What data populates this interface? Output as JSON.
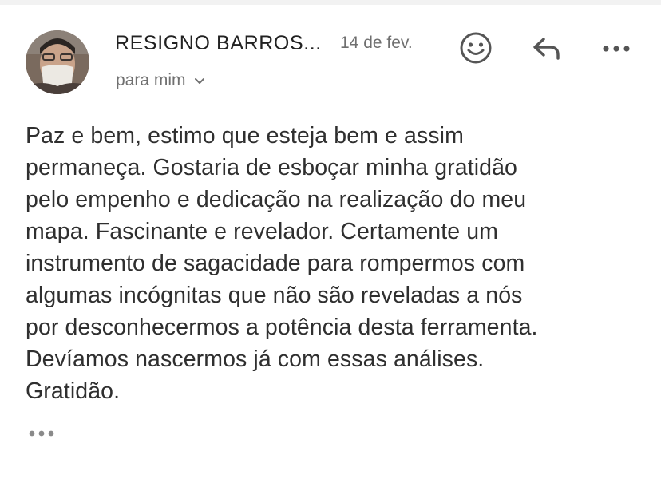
{
  "header": {
    "sender_name": "RESIGNO BARROS...",
    "date": "14 de fev.",
    "recipient": "para mim",
    "icons": {
      "avatar": "sender-avatar",
      "emoji": "emoji-reaction-icon",
      "reply": "reply-icon",
      "more": "more-options-icon",
      "recipient_toggle": "chevron-down-icon"
    }
  },
  "message": {
    "lines": [
      "Paz e bem, estimo que esteja bem e assim",
      "permaneça. Gostaria de esboçar minha gratidão",
      "pelo empenho e dedicação na realização do meu",
      "mapa. Fascinante e revelador. Certamente um",
      "instrumento de sagacidade para rompermos com",
      "algumas incógnitas que não são reveladas a nós",
      "por desconhecermos a potência desta ferramenta.",
      "Devíamos nascermos já com essas análises.",
      "Gratidão."
    ],
    "trimmed_content_icon": "show-trimmed-content-icon"
  },
  "colors": {
    "text": "#2f2f2f",
    "secondary_text": "#707070",
    "icon": "#555555",
    "background": "#ffffff"
  }
}
